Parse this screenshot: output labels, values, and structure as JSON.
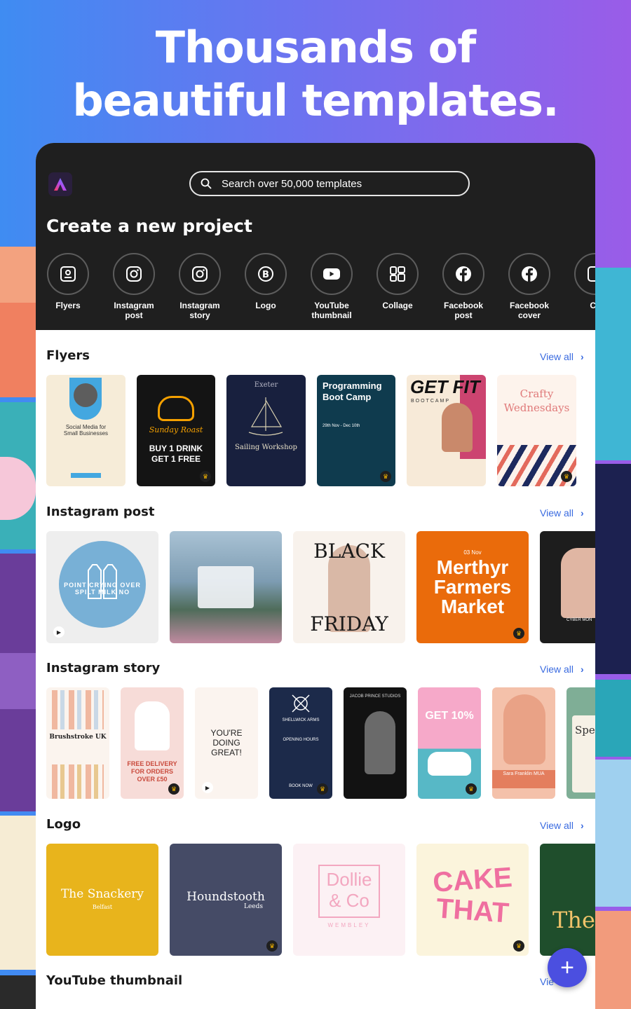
{
  "headline": {
    "line1": "Thousands of",
    "line2": "beautiful templates."
  },
  "search": {
    "placeholder": "Search over 50,000 templates",
    "icon": "search-icon"
  },
  "create": {
    "title": "Create a new project",
    "types": [
      {
        "label1": "Flyers",
        "label2": "",
        "icon": "flyer-icon"
      },
      {
        "label1": "Instagram",
        "label2": "post",
        "icon": "instagram-icon"
      },
      {
        "label1": "Instagram",
        "label2": "story",
        "icon": "instagram-icon"
      },
      {
        "label1": "Logo",
        "label2": "",
        "icon": "logo-b-icon"
      },
      {
        "label1": "YouTube",
        "label2": "thumbnail",
        "icon": "youtube-icon"
      },
      {
        "label1": "Collage",
        "label2": "",
        "icon": "collage-icon"
      },
      {
        "label1": "Facebook",
        "label2": "post",
        "icon": "facebook-icon"
      },
      {
        "label1": "Facebook",
        "label2": "cover",
        "icon": "facebook-icon"
      },
      {
        "label1": "Ca",
        "label2": "",
        "icon": "card-icon"
      }
    ]
  },
  "sections": {
    "flyers": {
      "title": "Flyers",
      "view_all": "View all"
    },
    "instagram_post": {
      "title": "Instagram post",
      "view_all": "View all"
    },
    "instagram_story": {
      "title": "Instagram story",
      "view_all": "View all"
    },
    "logo": {
      "title": "Logo",
      "view_all": "View all"
    },
    "youtube": {
      "title": "YouTube thumbnail",
      "view_all": "Vie"
    }
  },
  "flyer_cards": {
    "c1a": "Social Media for",
    "c1b": "Small Businesses",
    "c2a": "Sunday Roast",
    "c2b": "BUY 1 DRINK",
    "c2c": "GET 1 FREE",
    "c3a": "Exeter",
    "c3b": "Sailing Workshop",
    "c4a": "Programming",
    "c4b": "Boot Camp",
    "c4c": "29th Nov - Dec 10th",
    "c5a": "GET FIT",
    "c5b": "BOOTCAMP",
    "c6a": "Crafty",
    "c6b": "Wednesdays"
  },
  "post_cards": {
    "p1": "POINT CRYING OVER SPILT MILK NO",
    "p3a": "BLACK",
    "p3b": "FRIDAY",
    "p4a": "03 Nov",
    "p4b": "Merthyr",
    "p4c": "Farmers",
    "p4d": "Market",
    "p5": "CYBER MON"
  },
  "story_cards": {
    "s1": "Brushstroke UK",
    "s2a": "FREE DELIVERY",
    "s2b": "FOR ORDERS",
    "s2c": "OVER £50",
    "s3a": "YOU'RE",
    "s3b": "DOING",
    "s3c": "GREAT!",
    "s4a": "SHELLWICK ARMS",
    "s4b": "OPENING HOURS",
    "s4c": "BOOK NOW",
    "s5": "JACOB PRINCE STUDIOS",
    "s6": "GET 10%",
    "s7": "Sara Franklin MUA",
    "s8": "Spe"
  },
  "logo_cards": {
    "l1a": "The Snackery",
    "l1b": "Belfast",
    "l2a": "Houndstooth",
    "l2b": "Leeds",
    "l3a": "Dollie",
    "l3b": "& Co",
    "l3c": "WEMBLEY",
    "l4a": "CAKE",
    "l4b": "THAT",
    "l5": "The"
  },
  "fab": {
    "label": "+"
  },
  "colors": {
    "accent": "#3a6be0",
    "fab": "#4b4fe0",
    "topbar": "#1f1f1f"
  }
}
